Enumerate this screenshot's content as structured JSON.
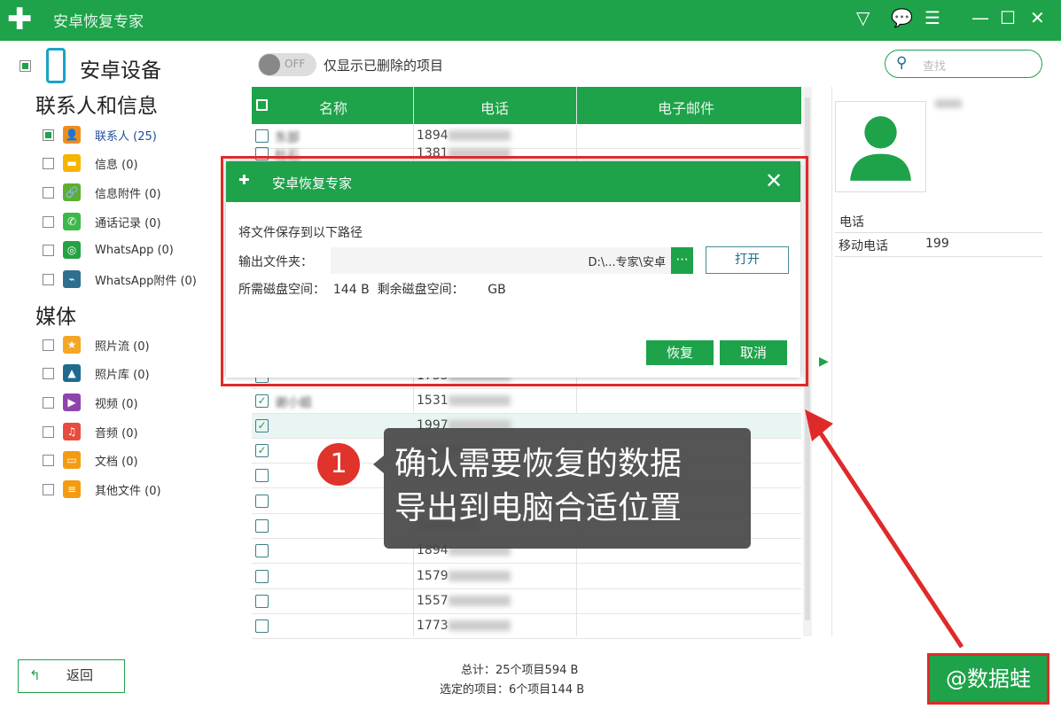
{
  "app": {
    "title": "安卓恢复专家",
    "brand_color": "#1ea24a",
    "icons": [
      "wifi-icon",
      "chat-icon",
      "menu-icon",
      "minimize-icon",
      "maximize-icon",
      "close-icon"
    ]
  },
  "sidebar": {
    "device": "安卓设备",
    "sections": [
      {
        "title": "联系人和信息",
        "items": [
          {
            "label": "联系人 (25)",
            "checked": true,
            "icon": "contacts-icon",
            "color": "#f08c1e"
          },
          {
            "label": "信息 (0)",
            "icon": "message-icon",
            "color": "#f5b500"
          },
          {
            "label": "信息附件 (0)",
            "icon": "attachment-icon",
            "color": "#5bb030"
          },
          {
            "label": "通话记录 (0)",
            "icon": "phone-icon",
            "color": "#3db84a"
          },
          {
            "label": "WhatsApp (0)",
            "icon": "whatsapp-icon",
            "color": "#25a244"
          },
          {
            "label": "WhatsApp附件 (0)",
            "icon": "whatsapp-attachment-icon",
            "color": "#2f6f8f"
          }
        ]
      },
      {
        "title": "媒体",
        "items": [
          {
            "label": "照片流 (0)",
            "icon": "star-icon",
            "color": "#f5a623"
          },
          {
            "label": "照片库 (0)",
            "icon": "image-icon",
            "color": "#1f6b8f"
          },
          {
            "label": "视频 (0)",
            "icon": "video-icon",
            "color": "#8e44ad"
          },
          {
            "label": "音频 (0)",
            "icon": "music-icon",
            "color": "#e74c3c"
          },
          {
            "label": "文档 (0)",
            "icon": "document-icon",
            "color": "#f39c12"
          },
          {
            "label": "其他文件 (0)",
            "icon": "file-icon",
            "color": "#f39c12"
          }
        ]
      }
    ],
    "back_label": "返回"
  },
  "toolbar": {
    "toggle": "OFF",
    "toggle_label": "仅显示已删除的项目",
    "search_placeholder": "查找"
  },
  "table": {
    "headers": [
      "名称",
      "电话",
      "电子邮件"
    ],
    "rows": [
      {
        "name": "东部",
        "phone": "1894",
        "checked": false
      },
      {
        "name": "杜石",
        "phone": "1381",
        "checked": false
      },
      {
        "name": "",
        "phone": "1753",
        "checked": false
      },
      {
        "name": "谢小姐",
        "phone": "1531",
        "checked": true
      },
      {
        "name": "",
        "phone": "1997",
        "checked": true,
        "selected": true
      },
      {
        "name": "",
        "phone": "",
        "checked": true
      },
      {
        "name": "",
        "phone": "",
        "checked": false
      },
      {
        "name": "",
        "phone": "",
        "checked": false
      },
      {
        "name": "",
        "phone": "",
        "checked": false
      },
      {
        "name": "",
        "phone": "1894",
        "checked": false
      },
      {
        "name": "",
        "phone": "1579",
        "checked": false
      },
      {
        "name": "",
        "phone": "1557",
        "checked": false
      },
      {
        "name": "",
        "phone": "1773",
        "checked": false
      }
    ]
  },
  "detail": {
    "phone_heading": "电话",
    "phone_type": "移动电话",
    "phone_value": "199"
  },
  "status": {
    "total": "总计：25个项目594 B",
    "selected": "选定的项目：6个项目144 B"
  },
  "dialog": {
    "title": "安卓恢复专家",
    "line1": "将文件保存到以下路径",
    "folder_label": "输出文件夹：",
    "folder_value": "D:\\...专家\\安卓",
    "browse": "···",
    "open": "打开",
    "disk": "所需磁盘空间：  144 B  剩余磁盘空间：      GB",
    "recover": "恢复",
    "cancel": "取消"
  },
  "annotation": {
    "step": "1",
    "line1": "确认需要恢复的数据",
    "line2": "导出到电脑合适位置",
    "watermark": "@数据蛙"
  }
}
